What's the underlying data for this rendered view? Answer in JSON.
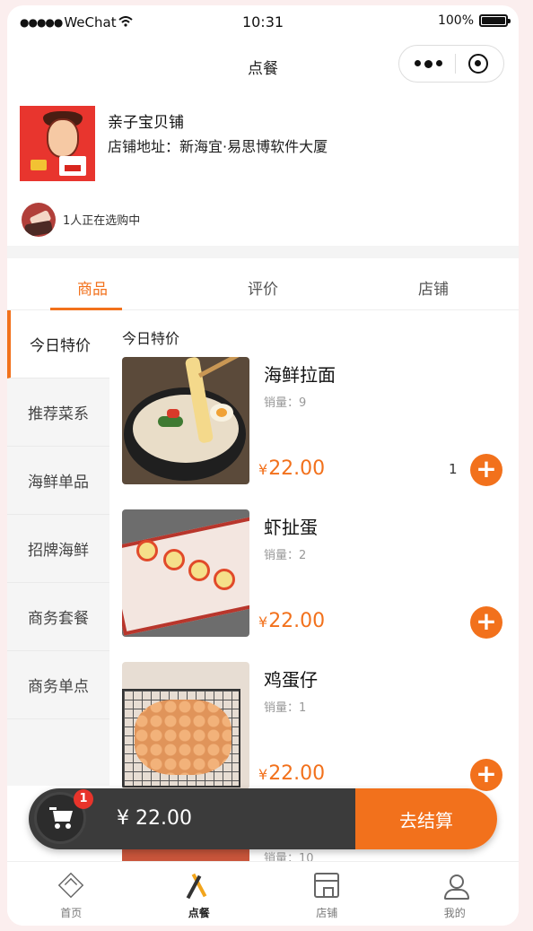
{
  "status_bar": {
    "carrier": "WeChat",
    "time": "10:31",
    "battery": "100%"
  },
  "nav": {
    "title": "点餐"
  },
  "shop": {
    "name": "亲子宝贝铺",
    "address": "店铺地址：新海宜·易思博软件大厦",
    "browsing": "1人正在选购中"
  },
  "tabs": [
    {
      "label": "商品",
      "active": true
    },
    {
      "label": "评价",
      "active": false
    },
    {
      "label": "店铺",
      "active": false
    }
  ],
  "categories": [
    {
      "label": "今日特价",
      "active": true
    },
    {
      "label": "推荐菜系",
      "active": false
    },
    {
      "label": "海鲜单品",
      "active": false
    },
    {
      "label": "招牌海鲜",
      "active": false
    },
    {
      "label": "商务套餐",
      "active": false
    },
    {
      "label": "商务单点",
      "active": false
    }
  ],
  "section_title": "今日特价",
  "items": [
    {
      "name": "海鲜拉面",
      "sales": "销量：9",
      "currency": "¥",
      "price": "22.00",
      "qty": "1"
    },
    {
      "name": "虾扯蛋",
      "sales": "销量：2",
      "currency": "¥",
      "price": "22.00",
      "qty": ""
    },
    {
      "name": "鸡蛋仔",
      "sales": "销量：1",
      "currency": "¥",
      "price": "22.00",
      "qty": ""
    }
  ],
  "partial_item": {
    "sales": "销量：10"
  },
  "add_symbol": "+",
  "cart": {
    "badge": "1",
    "total": "¥ 22.00",
    "checkout_label": "去结算"
  },
  "tabbar": [
    {
      "label": "首页",
      "icon": "home-icon",
      "active": false
    },
    {
      "label": "点餐",
      "icon": "order-icon",
      "active": true
    },
    {
      "label": "店铺",
      "icon": "store-icon",
      "active": false
    },
    {
      "label": "我的",
      "icon": "profile-icon",
      "active": false
    }
  ],
  "colors": {
    "accent": "#f2711c",
    "cart_bar": "#3b3b3b",
    "badge": "#e8342b"
  }
}
